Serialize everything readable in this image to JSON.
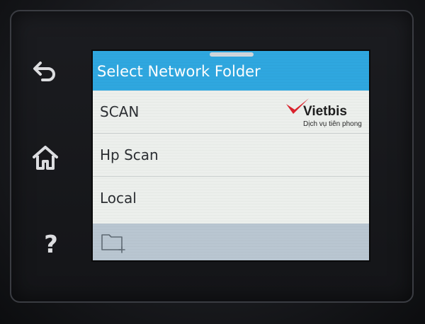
{
  "screen": {
    "title": "Select Network Folder",
    "items": [
      {
        "label": "SCAN"
      },
      {
        "label": "Hp Scan"
      },
      {
        "label": "Local"
      }
    ]
  },
  "side_buttons": {
    "back": {
      "icon": "back-arrow-icon"
    },
    "home": {
      "icon": "home-icon"
    },
    "help": {
      "icon": "question-mark-icon",
      "glyph": "?"
    }
  },
  "footer": {
    "new_folder_icon": "new-folder-icon"
  },
  "watermark": {
    "brand": "Vietbis",
    "tagline": "Dịch vụ tiên phong"
  },
  "colors": {
    "title_bar": "#2fa7df",
    "screen_bg": "#ecefec",
    "footer_bar": "#b9c6d1",
    "bezel": "#141518",
    "watermark_accent": "#d9232d"
  }
}
